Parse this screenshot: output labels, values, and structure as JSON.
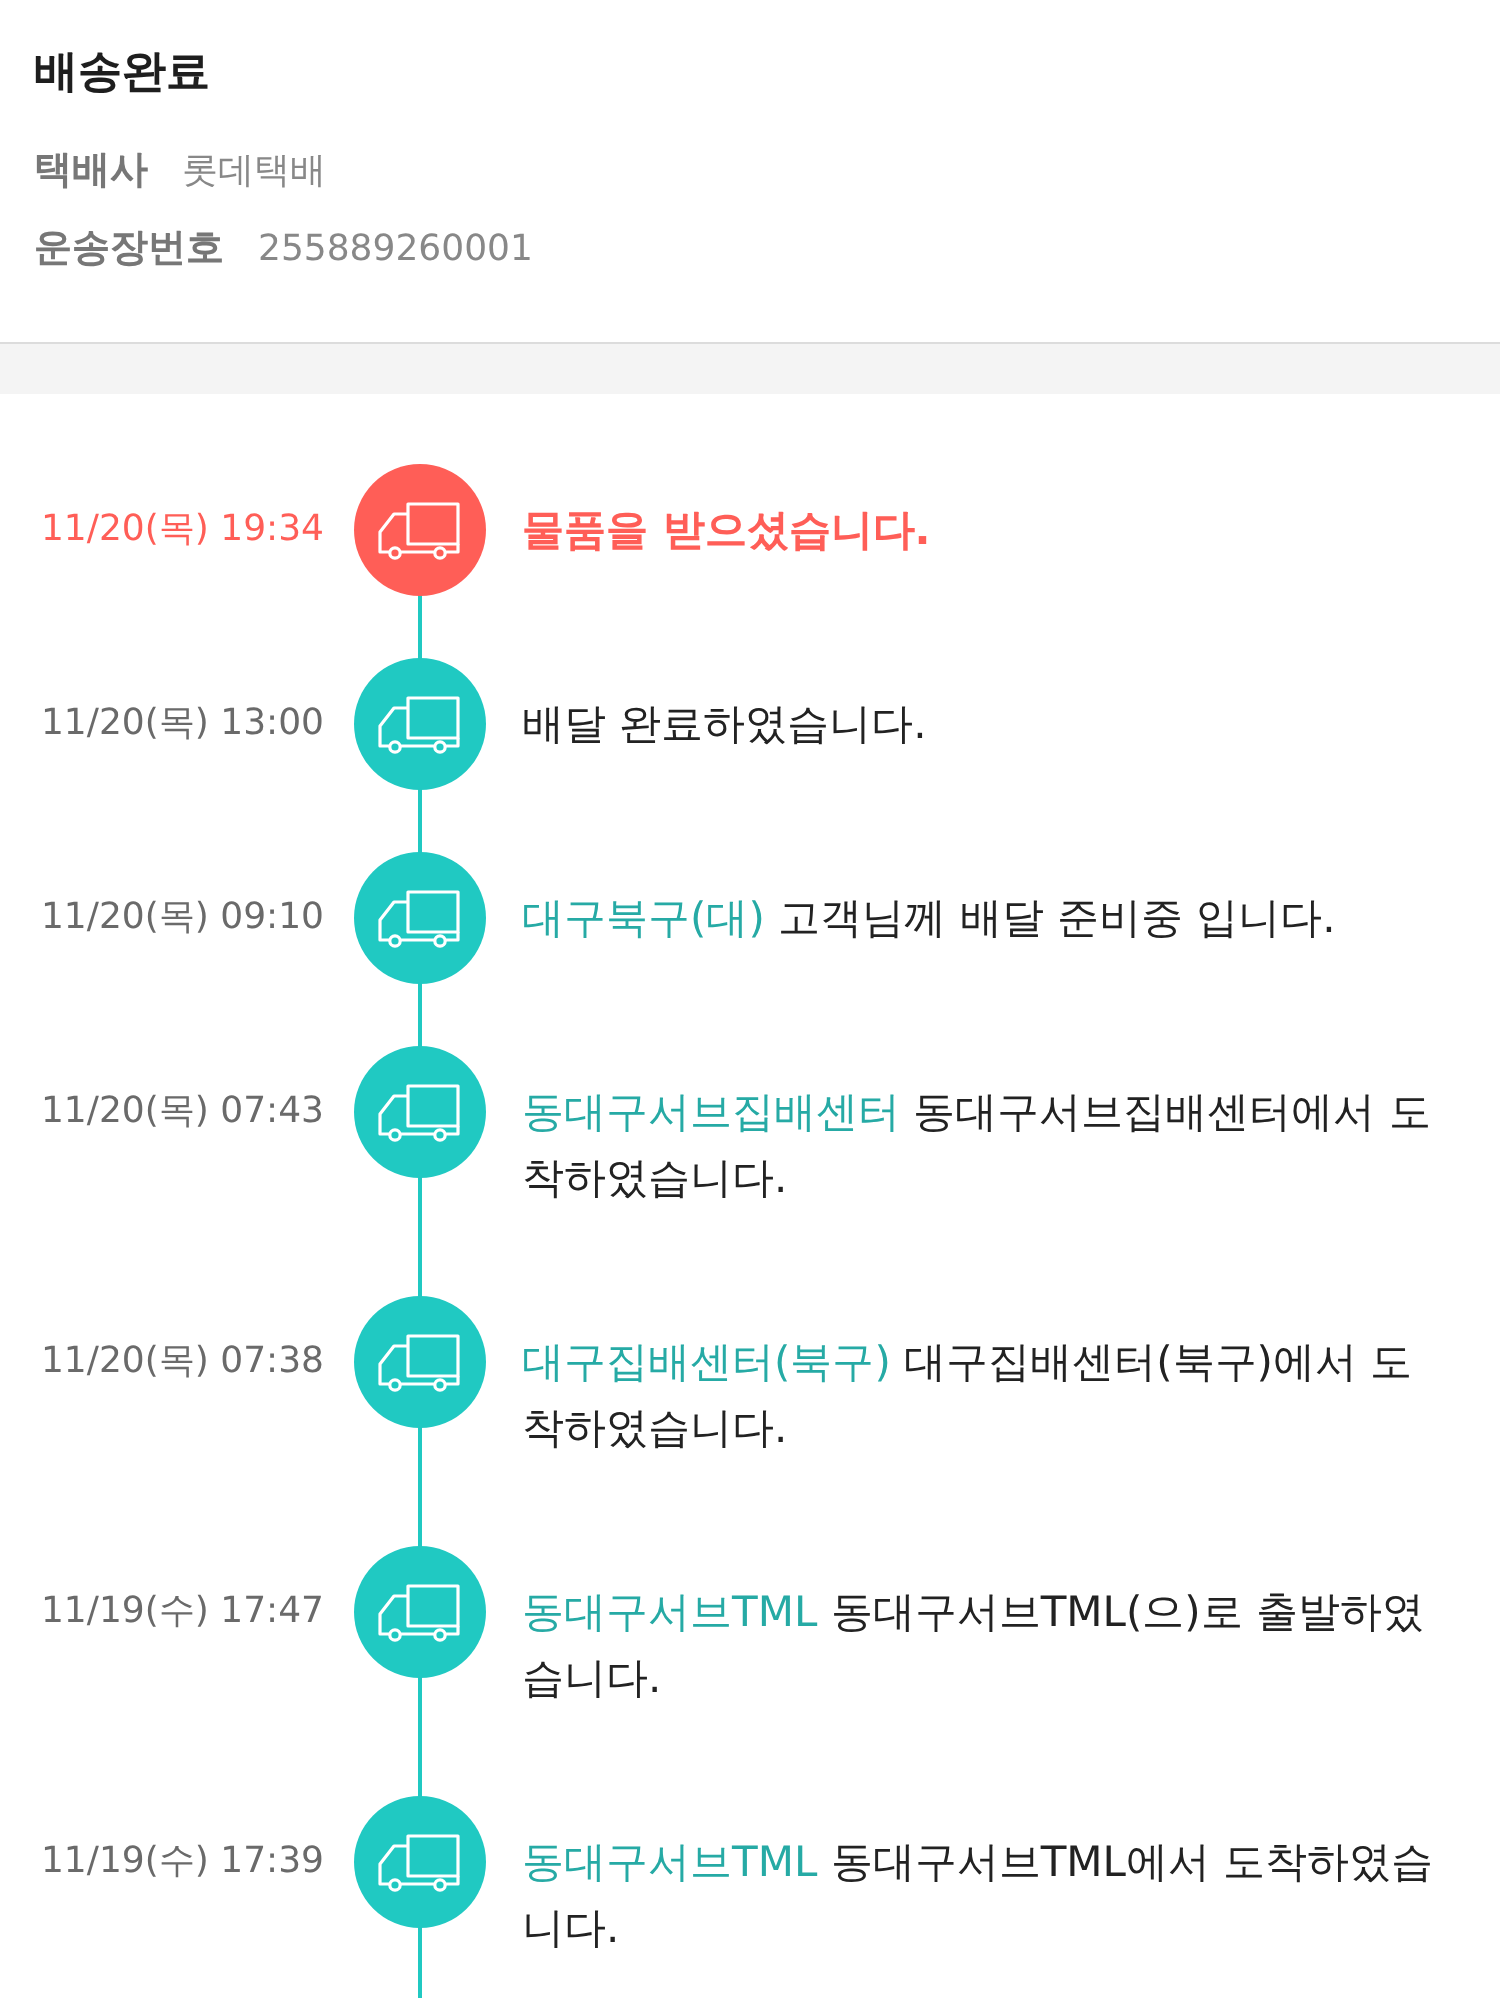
{
  "header": {
    "title": "배송완료",
    "fields": [
      {
        "label": "택배사",
        "value": "롯데택배"
      },
      {
        "label": "운송장번호",
        "value": "255889260001"
      }
    ]
  },
  "events": [
    {
      "time": "11/20(목) 19:34",
      "message": "물품을 받으셨습니다.",
      "current": true
    },
    {
      "time": "11/20(목) 13:00",
      "message": "배달 완료하였습니다.",
      "current": false
    },
    {
      "time": "11/20(목) 09:10",
      "location": "대구북구(대)",
      "message": "고객님께 배달 준비중 입니다.",
      "current": false
    },
    {
      "time": "11/20(목) 07:43",
      "location": "동대구서브집배센터",
      "message": "동대구서브집배센터에서 도착하였습니다.",
      "current": false
    },
    {
      "time": "11/20(목) 07:38",
      "location": "대구집배센터(북구)",
      "message": "대구집배센터(북구)에서 도착하였습니다.",
      "current": false
    },
    {
      "time": "11/19(수) 17:47",
      "location": "동대구서브TML",
      "message": "동대구서브TML(으)로 출발하였습니다.",
      "current": false
    },
    {
      "time": "11/19(수) 17:39",
      "location": "동대구서브TML",
      "message": "동대구서브TML에서 도착하였습니다.",
      "current": false
    }
  ]
}
